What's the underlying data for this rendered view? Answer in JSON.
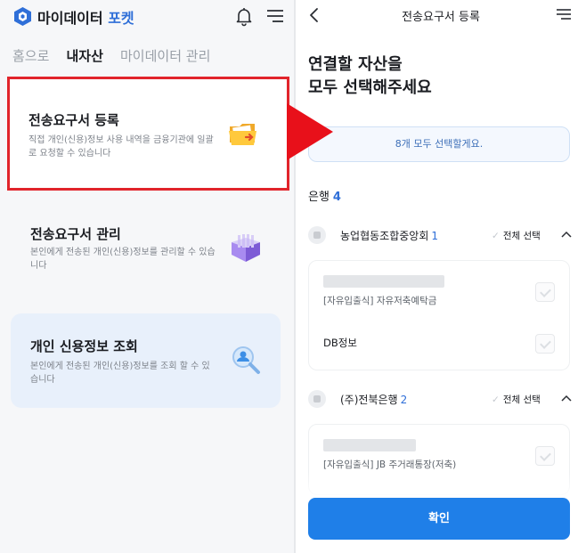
{
  "left": {
    "app_title_main": "마이데이터",
    "app_title_accent": "포켓",
    "tabs": [
      {
        "label": "홈으로",
        "active": false
      },
      {
        "label": "내자산",
        "active": true
      },
      {
        "label": "마이데이터 관리",
        "active": false
      }
    ],
    "cards": [
      {
        "title": "전송요구서 등록",
        "desc": "직접 개인(신용)정보 사용 내역을 금융기관에 일괄로 요청할 수 있습니다",
        "icon": "folder-icon"
      },
      {
        "title": "전송요구서 관리",
        "desc": "본인에게 전송된 개인(신용)정보를 관리할 수 있습니다",
        "icon": "box-icon"
      },
      {
        "title": "개인 신용정보 조회",
        "desc": "본인에게 전송된 개인(신용)정보를 조회 할 수 있습니다",
        "icon": "magnifier-icon"
      }
    ]
  },
  "right": {
    "title": "전송요구서 등록",
    "headline_line1": "연결할 자산을",
    "headline_line2": "모두 선택해주세요",
    "select_all": "8개 모두 선택할게요.",
    "section_label": "은행",
    "section_count": "4",
    "banks": [
      {
        "name": "농업협동조합중앙회",
        "count": "1",
        "check_all": "전체 선택",
        "accounts": [
          {
            "name": "[자유입출식] 자유저축예탁금",
            "masked": true
          },
          {
            "name": "DB정보",
            "masked": false
          }
        ]
      },
      {
        "name": "(주)전북은행",
        "count": "2",
        "check_all": "전체 선택",
        "accounts": [
          {
            "name": "[자유입출식] JB 주거래통장(저축)",
            "masked": true
          }
        ]
      }
    ],
    "confirm": "확인"
  },
  "colors": {
    "accent": "#2f6fd8",
    "button": "#1f7fe8",
    "highlight": "#e1242b"
  }
}
